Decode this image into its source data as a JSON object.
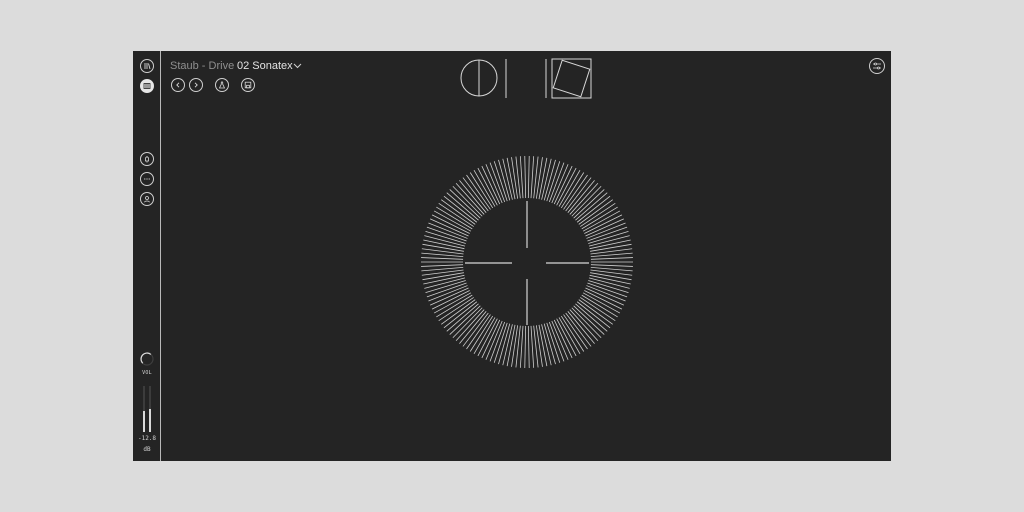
{
  "header": {
    "title": "Staub - Drive",
    "preset_name": "02 Sonatex"
  },
  "sidebar": {
    "top_icons": [
      "library-icon",
      "piano-keys-icon"
    ],
    "middle_icons": [
      "bell-icon",
      "more-dots-icon",
      "user-icon"
    ],
    "vol_label": "VOL",
    "volume_level": 0.65,
    "meter_value": "-12.8",
    "meter_unit": "dB",
    "meter_levels": [
      0.45,
      0.5
    ]
  },
  "toolbar": {
    "icons": [
      "prev-arrow-icon",
      "next-arrow-icon",
      "flask-icon",
      "save-icon"
    ]
  },
  "mode_icons": [
    "split-circle-icon",
    "rotated-square-icon"
  ],
  "settings_icon": "sliders-icon",
  "colors": {
    "background": "#242424",
    "foreground": "#d9d9d9",
    "muted_text": "#8f8f8f",
    "page_bg": "#dcdcdc"
  }
}
